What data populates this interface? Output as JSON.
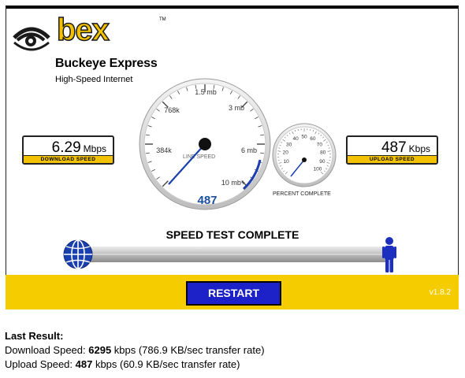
{
  "brand": {
    "logo_text": "bex",
    "name": "Buckeye Express",
    "tagline": "High-Speed Internet",
    "accent_color": "#f2c200"
  },
  "download": {
    "value": "6.29",
    "unit": "Mbps",
    "label": "DOWNLOAD SPEED"
  },
  "upload": {
    "value": "487",
    "unit": "Kbps",
    "label": "UPLOAD SPEED"
  },
  "line_gauge": {
    "label": "LINE SPEED",
    "ticks": [
      "384k",
      "768k",
      "1.5 mb",
      "3 mb",
      "6 mb",
      "10 mb+"
    ],
    "value": "487"
  },
  "percent_gauge": {
    "label": "PERCENT COMPLETE",
    "ticks": [
      "10",
      "20",
      "30",
      "40",
      "50",
      "60",
      "70",
      "80",
      "90",
      "100"
    ],
    "percent": 0
  },
  "status": {
    "title": "SPEED TEST COMPLETE"
  },
  "controls": {
    "restart_label": "RESTART",
    "version": "v1.8.2"
  },
  "last_result": {
    "heading": "Last Result:",
    "download_prefix": "Download Speed: ",
    "download_value": "6295",
    "download_suffix": " kbps (786.9 KB/sec transfer rate)",
    "upload_prefix": "Upload Speed: ",
    "upload_value": "487",
    "upload_suffix": " kbps (60.9 KB/sec transfer rate)"
  },
  "icons": {
    "globe": "globe-icon",
    "person": "person-icon",
    "eye": "eye-logo-icon"
  }
}
